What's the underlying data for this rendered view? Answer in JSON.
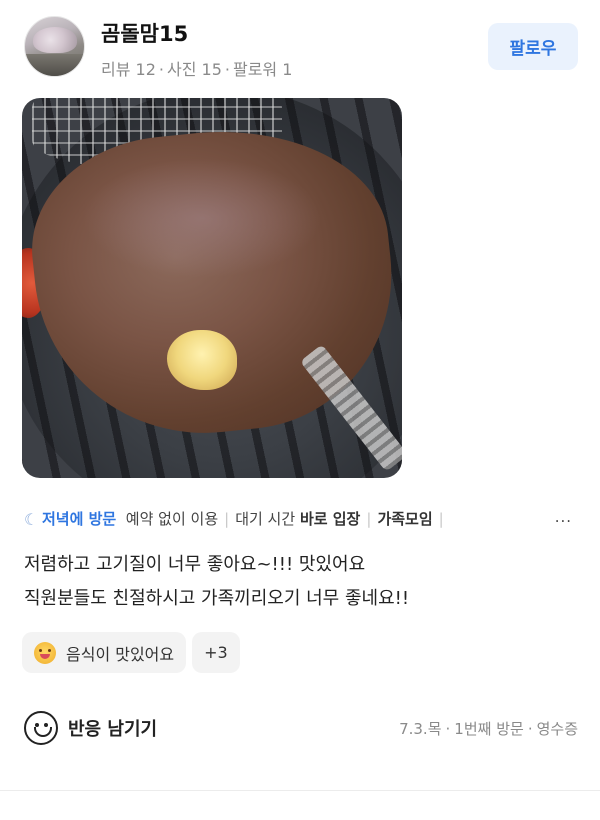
{
  "user": {
    "name": "곰돌맘15",
    "stats": [
      "리뷰 12",
      "사진 15",
      "팔로워 1"
    ],
    "follow_label": "팔로우"
  },
  "photo": {
    "subject": "grilled beef on a round grill"
  },
  "visit_tags": {
    "time": "저녁에 방문",
    "items": [
      {
        "prefix": "예약 없이 이용",
        "bold": ""
      },
      {
        "prefix": "대기 시간 ",
        "bold": "바로 입장"
      },
      {
        "prefix": "",
        "bold": "가족모임"
      }
    ],
    "more": "..."
  },
  "review": {
    "lines": [
      "저렴하고 고기질이 너무 좋아요~!!! 맛있어요",
      "직원분들도 친절하시고 가족끼리오기 너무 좋네요!!"
    ]
  },
  "keyword_chips": {
    "first": "음식이 맛있어요",
    "more": "+3"
  },
  "footer": {
    "react_label": "반응 남기기",
    "meta": [
      "7.3.목",
      "1번째 방문",
      "영수증"
    ]
  },
  "colors": {
    "accent": "#2f76e0",
    "follow_bg": "#eaf2fd",
    "chip_bg": "#f3f3f3",
    "muted": "#8a8a8a"
  }
}
